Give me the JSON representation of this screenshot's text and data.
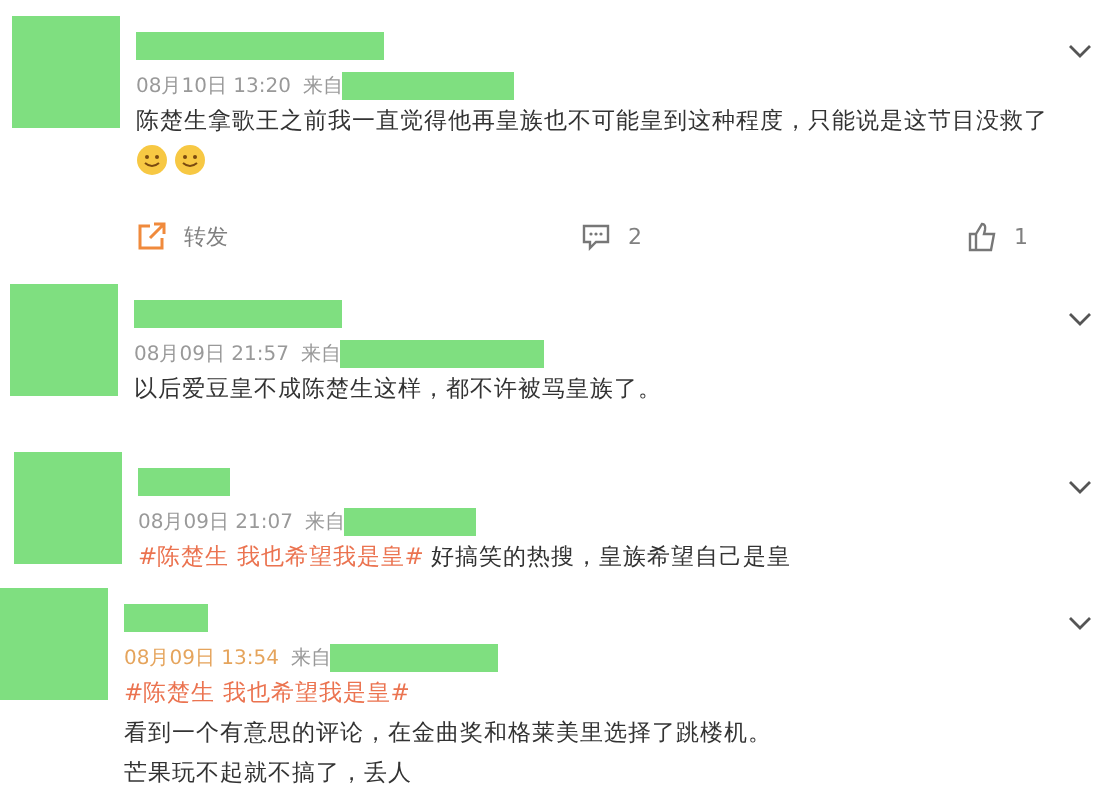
{
  "comments": [
    {
      "date": "08月10日 13:20",
      "source_label": "来自",
      "date_highlighted": false,
      "lines": [
        {
          "text": "陈楚生拿歌王之前我一直觉得他再皇族也不可能皇到这种程度，只能说是这节目没救了"
        }
      ],
      "emojis": [
        {
          "kind": "smile"
        },
        {
          "kind": "smile"
        }
      ],
      "actions": {
        "repost": "转发",
        "comments": "2",
        "likes": "1"
      }
    },
    {
      "date": "08月09日 21:57",
      "source_label": "来自",
      "date_highlighted": false,
      "lines": [
        {
          "text": "以后爱豆皇不成陈楚生这样，都不许被骂皇族了。"
        }
      ]
    },
    {
      "date": "08月09日 21:07",
      "source_label": "来自",
      "date_highlighted": false,
      "lines": [
        {
          "hashtag": "#陈楚生 我也希望我是皇#",
          "text": "好搞笑的热搜，皇族希望自己是皇"
        }
      ]
    },
    {
      "date": "08月09日 13:54",
      "source_label": "来自",
      "date_highlighted": true,
      "lines": [
        {
          "hashtag": "#陈楚生 我也希望我是皇#"
        },
        {
          "text": "看到一个有意思的评论，在金曲奖和格莱美里选择了跳楼机。"
        },
        {
          "text": "芒果玩不起就不搞了，丢人"
        }
      ]
    }
  ]
}
